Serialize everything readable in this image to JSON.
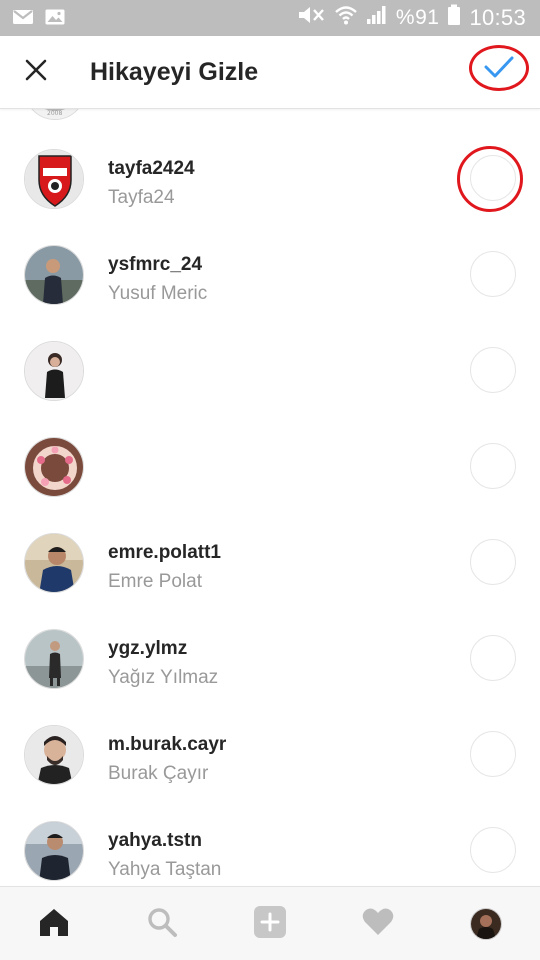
{
  "status_bar": {
    "left_icons": [
      "gmail-icon",
      "gallery-icon"
    ],
    "right_icons": [
      "mute-icon",
      "wifi-icon",
      "signal-icon",
      "battery-icon"
    ],
    "battery": "%91",
    "time": "10:53"
  },
  "header": {
    "title": "Hikayeyi Gizle",
    "close_icon": "close-icon",
    "confirm_icon": "checkmark-icon",
    "accent_color": "#3897f0",
    "highlight_color": "#e0181e"
  },
  "users": [
    {
      "username": "tayfa2424",
      "full_name": "Tayfa24",
      "selected": false,
      "highlighted": true
    },
    {
      "username": "ysfmrc_24",
      "full_name": "Yusuf Meric",
      "selected": false,
      "highlighted": false
    },
    {
      "username": "",
      "full_name": "",
      "selected": false,
      "highlighted": false
    },
    {
      "username": "",
      "full_name": "",
      "selected": false,
      "highlighted": false
    },
    {
      "username": "emre.polatt1",
      "full_name": "Emre Polat",
      "selected": false,
      "highlighted": false
    },
    {
      "username": "ygz.ylmz",
      "full_name": "Yağız Yılmaz",
      "selected": false,
      "highlighted": false
    },
    {
      "username": "m.burak.cayr",
      "full_name": "Burak Çayır",
      "selected": false,
      "highlighted": false
    },
    {
      "username": "yahya.tstn",
      "full_name": "Yahya Taştan",
      "selected": false,
      "highlighted": false
    }
  ],
  "bottom_nav": {
    "items": [
      "home-icon",
      "search-icon",
      "add-post-icon",
      "activity-heart-icon",
      "profile-avatar"
    ],
    "active": "home-icon"
  }
}
